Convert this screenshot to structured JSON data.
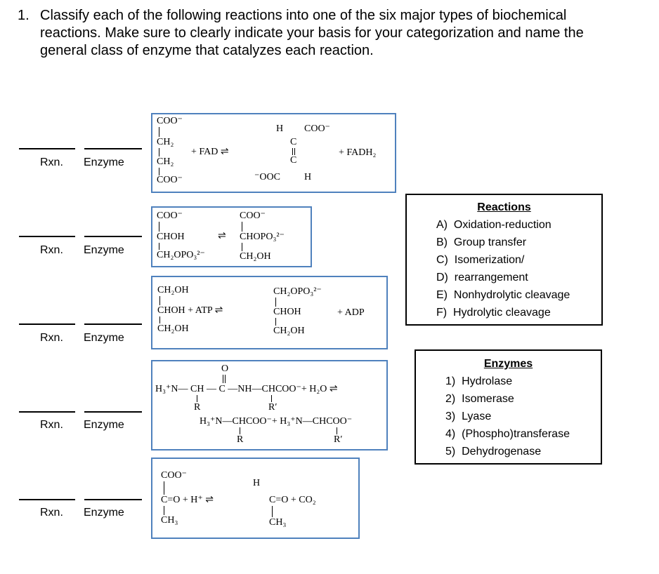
{
  "question": {
    "number": "1.",
    "lines": [
      "Classify each of the following reactions into one of the six major types of biochemical",
      "reactions. Make sure to clearly indicate your basis for your categorization and name the",
      "general class of enzyme that catalyzes each reaction."
    ]
  },
  "answer_labels": {
    "rxn": "Rxn.",
    "enzyme": "Enzyme"
  },
  "reactions": [
    {
      "texts": [
        "COO⁻",
        "CH₂",
        "CH₂",
        "COO⁻",
        "+ FAD ⇌",
        "H",
        "COO⁻",
        "C",
        "C",
        "⁻OOC",
        "H",
        "+ FADH₂"
      ]
    },
    {
      "texts": [
        "COO⁻",
        "CHOH",
        "CH₂OPO₃²⁻",
        "⇌",
        "COO⁻",
        "CHOPO₃²⁻",
        "CH₂OH"
      ]
    },
    {
      "texts": [
        "CH₂OH",
        "CHOH + ATP ⇌",
        "CH₂OH",
        "CH₂OPO₃²⁻",
        "CHOH",
        "CH₂OH",
        "+ ADP"
      ]
    },
    {
      "texts": [
        "O",
        "H₃⁺N— CH — C —NH—CHCOO⁻+ H₂O ⇌",
        "R",
        "R′",
        "H₃⁺N—CHCOO⁻+ H₃⁺N—CHCOO⁻",
        "R",
        "R′"
      ]
    },
    {
      "texts": [
        "COO⁻",
        "C=O + H⁺ ⇌",
        "CH₃",
        "H",
        "C=O + CO₂",
        "CH₃"
      ]
    }
  ],
  "reaction_types": {
    "title": "Reactions",
    "items": [
      "A)  Oxidation-reduction",
      "B)  Group transfer",
      "C)  Isomerization/",
      "D)  rearrangement",
      "E)  Nonhydrolytic cleavage",
      "F)  Hydrolytic cleavage"
    ]
  },
  "enzymes": {
    "title": "Enzymes",
    "items": [
      "1)  Hydrolase",
      "2)  Isomerase",
      "3)  Lyase",
      "4)  (Phospho)transferase",
      "5)  Dehydrogenase"
    ]
  },
  "colors": {
    "box_border": "#4f81bd"
  }
}
